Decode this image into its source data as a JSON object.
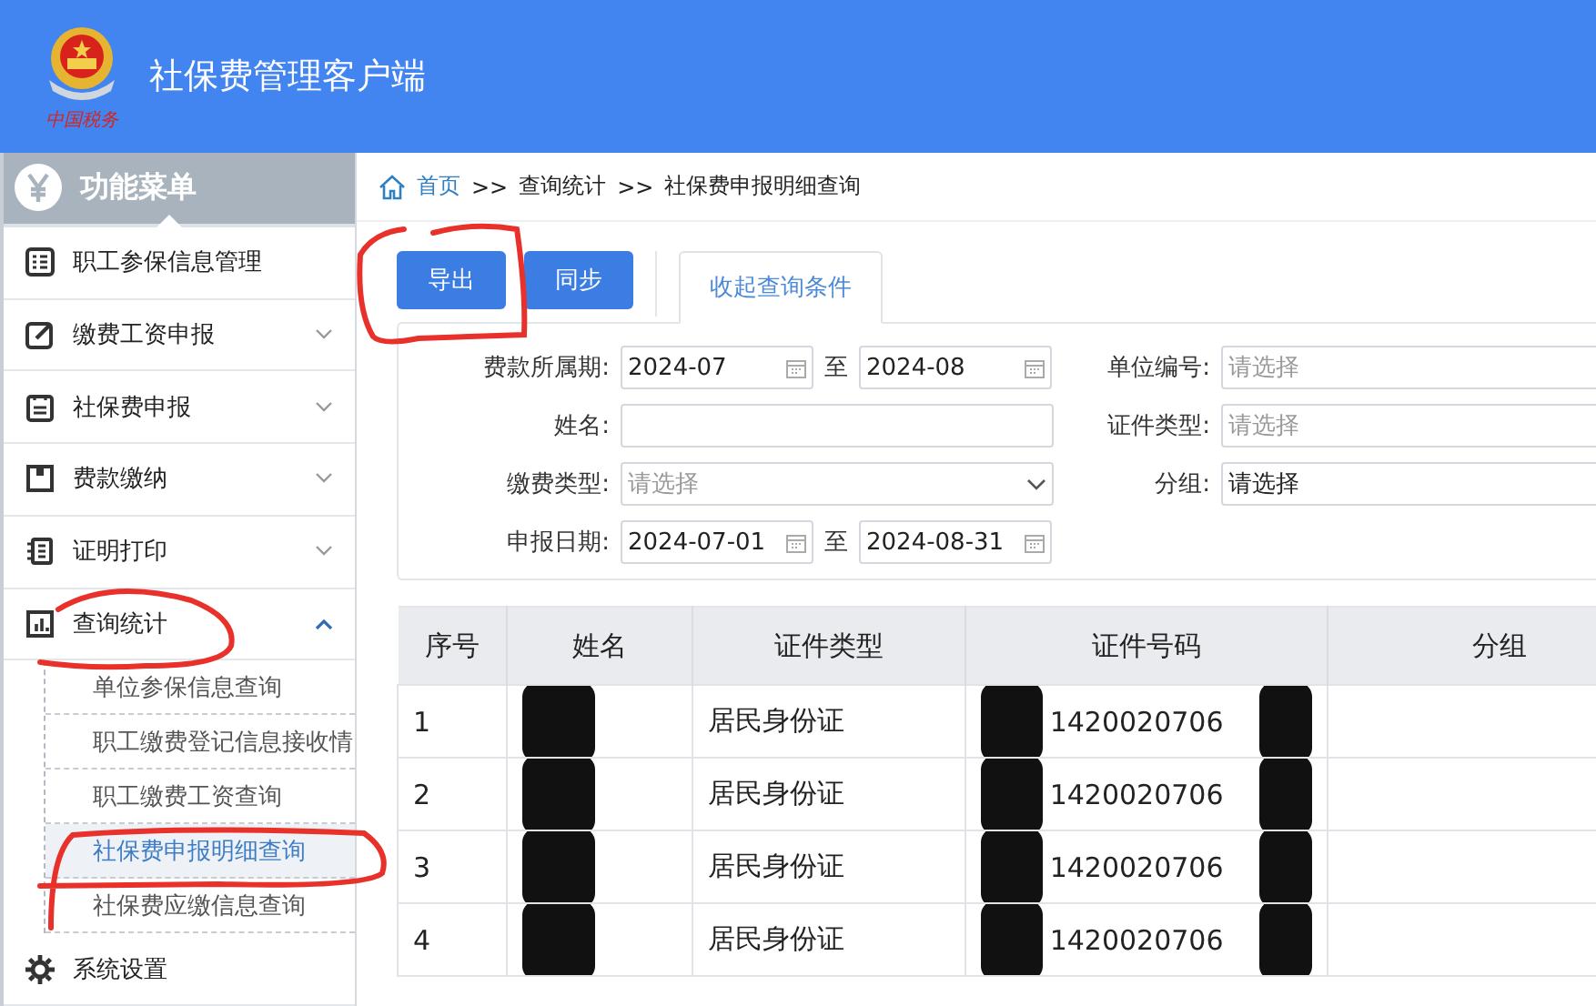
{
  "header": {
    "title": "社保费管理客户端",
    "emblem_caption": "中国税务"
  },
  "sidebar": {
    "title": "功能菜单",
    "items": [
      {
        "label": "职工参保信息管理",
        "kind": "leaf"
      },
      {
        "label": "缴费工资申报",
        "kind": "group",
        "expanded": false
      },
      {
        "label": "社保费申报",
        "kind": "group",
        "expanded": false
      },
      {
        "label": "费款缴纳",
        "kind": "group",
        "expanded": false
      },
      {
        "label": "证明打印",
        "kind": "group",
        "expanded": false
      },
      {
        "label": "查询统计",
        "kind": "group",
        "expanded": true,
        "children": [
          {
            "label": "单位参保信息查询",
            "selected": false
          },
          {
            "label": "职工缴费登记信息接收情",
            "selected": false
          },
          {
            "label": "职工缴费工资查询",
            "selected": false
          },
          {
            "label": "社保费申报明细查询",
            "selected": true
          },
          {
            "label": "社保费应缴信息查询",
            "selected": false
          }
        ]
      },
      {
        "label": "系统设置",
        "kind": "leaf"
      }
    ]
  },
  "breadcrumb": [
    {
      "label": "首页",
      "kind": "link"
    },
    {
      "label": ">>",
      "kind": "sep"
    },
    {
      "label": "查询统计",
      "kind": "text"
    },
    {
      "label": ">>",
      "kind": "sep"
    },
    {
      "label": "社保费申报明细查询",
      "kind": "text"
    }
  ],
  "toolbar": {
    "buttons": [
      "导出",
      "同步"
    ],
    "tab": "收起查询条件"
  },
  "query_form": {
    "left": [
      {
        "label": "费款所属期:",
        "kind": "range",
        "from": "2024-07",
        "separator": "至",
        "to": "2024-08"
      },
      {
        "label": "姓名:",
        "kind": "text"
      },
      {
        "label": "缴费类型:",
        "kind": "select",
        "placeholder": "请选择"
      },
      {
        "label": "申报日期:",
        "kind": "range",
        "from": "2024-07-01",
        "separator": "至",
        "to": "2024-08-31"
      }
    ],
    "right": [
      {
        "label": "单位编号:",
        "kind": "text",
        "placeholder": "请选择"
      },
      {
        "label": "证件类型:",
        "kind": "text",
        "placeholder": "请选择"
      },
      {
        "label": "分组:",
        "kind": "text",
        "value": "请选择"
      }
    ]
  },
  "table": {
    "columns": [
      "序号",
      "姓名",
      "证件类型",
      "证件号码",
      "分组"
    ],
    "rows": [
      {
        "index": "1",
        "name_redacted": true,
        "id_type": "居民身份证",
        "id_number": "1420020706",
        "id_redacted": true
      },
      {
        "index": "2",
        "name_redacted": true,
        "id_type": "居民身份证",
        "id_number": "1420020706",
        "id_redacted": true
      },
      {
        "index": "3",
        "name_redacted": true,
        "id_type": "居民身份证",
        "id_number": "1420020706",
        "id_redacted": true
      },
      {
        "index": "4",
        "name_redacted": true,
        "id_type": "居民身份证",
        "id_number": "1420020706",
        "id_redacted": true
      }
    ]
  }
}
